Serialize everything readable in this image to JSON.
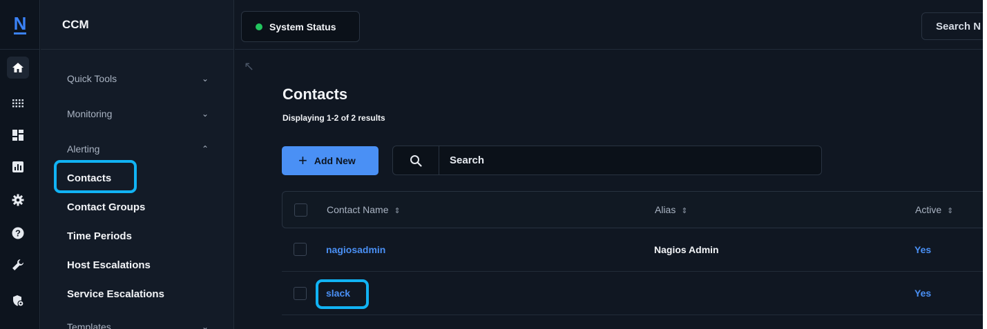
{
  "app": {
    "logo": "N",
    "title": "CCM"
  },
  "rail": {
    "icons": [
      "home-icon",
      "apps-grid-icon",
      "dashboard-icon",
      "reports-chart-icon",
      "settings-gear-icon",
      "help-icon",
      "tools-wrench-icon",
      "admin-shield-icon"
    ]
  },
  "sidebar": {
    "groups": [
      {
        "label": "Quick Tools",
        "expanded": false
      },
      {
        "label": "Monitoring",
        "expanded": false
      },
      {
        "label": "Alerting",
        "expanded": true
      },
      {
        "label": "Templates",
        "expanded": false
      }
    ],
    "alerting_items": [
      "Contacts",
      "Contact Groups",
      "Time Periods",
      "Host Escalations",
      "Service Escalations"
    ],
    "active_item": "Contacts"
  },
  "topbar": {
    "status_label": "System Status",
    "status_color": "#22c55e",
    "search_label": "Search N"
  },
  "main": {
    "title": "Contacts",
    "subtitle": "Displaying 1-2 of 2 results",
    "add_button": "Add New",
    "search_placeholder": "Search",
    "columns": [
      "Contact Name",
      "Alias",
      "Active"
    ],
    "rows": [
      {
        "name": "nagiosadmin",
        "alias": "Nagios Admin",
        "active": "Yes"
      },
      {
        "name": "slack",
        "alias": "",
        "active": "Yes"
      }
    ]
  },
  "colors": {
    "accent": "#4a90f5",
    "highlight": "#11b3f4",
    "background": "#101722"
  }
}
